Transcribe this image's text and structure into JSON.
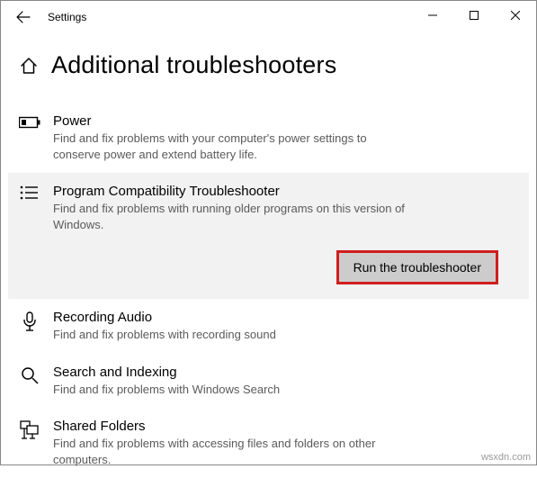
{
  "window": {
    "title": "Settings"
  },
  "page": {
    "title": "Additional troubleshooters"
  },
  "items": [
    {
      "title": "Power",
      "desc": "Find and fix problems with your computer's power settings to conserve power and extend battery life."
    },
    {
      "title": "Program Compatibility Troubleshooter",
      "desc": "Find and fix problems with running older programs on this version of Windows.",
      "run_label": "Run the troubleshooter"
    },
    {
      "title": "Recording Audio",
      "desc": "Find and fix problems with recording sound"
    },
    {
      "title": "Search and Indexing",
      "desc": "Find and fix problems with Windows Search"
    },
    {
      "title": "Shared Folders",
      "desc": "Find and fix problems with accessing files and folders on other computers."
    }
  ],
  "watermark": "wsxdn.com"
}
